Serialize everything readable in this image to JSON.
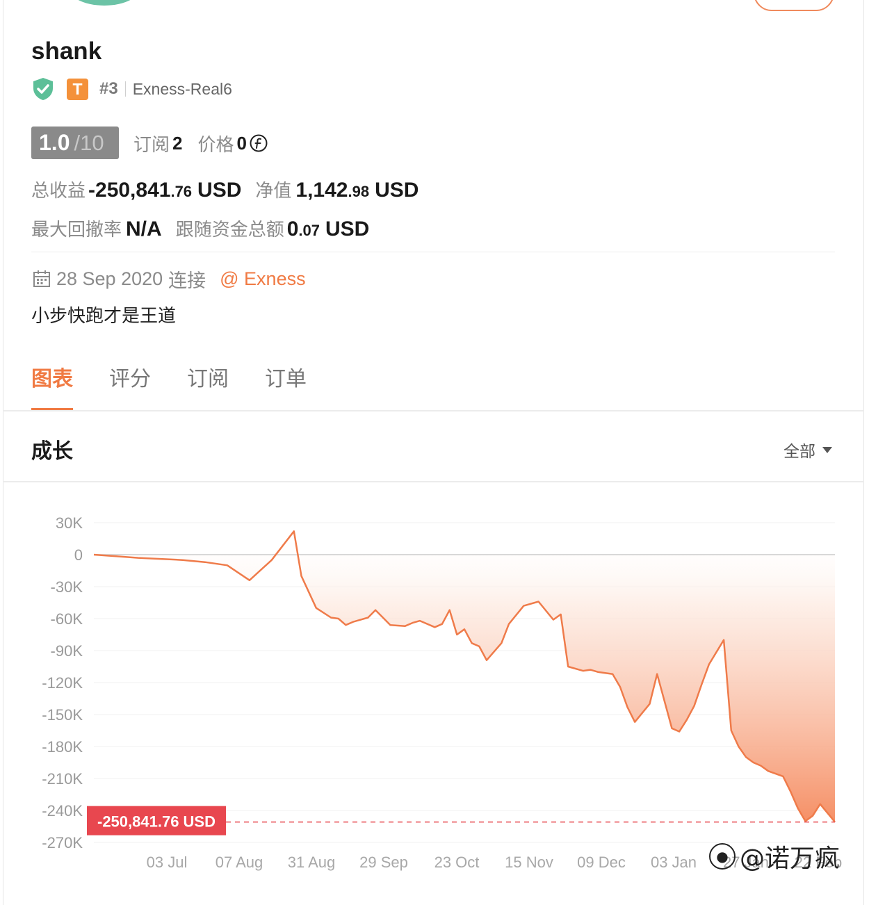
{
  "profile": {
    "name": "shank",
    "rank": "#3",
    "tier_badge": "T",
    "server": "Exness-Real6",
    "score": "1.0",
    "score_max": "/10",
    "subscribe_label": "订阅",
    "subscribe_count": "2",
    "price_label": "价格",
    "price_value": "0",
    "total_profit_label": "总收益",
    "total_profit_main": "-250,841",
    "total_profit_dec": ".76",
    "total_profit_unit": "USD",
    "equity_label": "净值",
    "equity_main": "1,142",
    "equity_dec": ".98",
    "equity_unit": "USD",
    "max_drawdown_label": "最大回撤率",
    "max_drawdown_value": "N/A",
    "follow_funds_label": "跟随资金总额",
    "follow_funds_main": "0",
    "follow_funds_dec": ".07",
    "follow_funds_unit": "USD",
    "connect_date": "28 Sep 2020",
    "connect_label": "连接",
    "broker": "@ Exness",
    "motto": "小步快跑才是王道"
  },
  "tabs": [
    {
      "label": "图表",
      "active": true
    },
    {
      "label": "评分",
      "active": false
    },
    {
      "label": "订阅",
      "active": false
    },
    {
      "label": "订单",
      "active": false
    }
  ],
  "growth": {
    "title": "成长",
    "range": "全部"
  },
  "colors": {
    "accent": "#f07a43",
    "line": "#ef7b4a",
    "badge_red": "#e8474f",
    "shield": "#5cbf98",
    "tier": "#f4913a"
  },
  "icons": [
    "shield-check-icon",
    "coin-icon",
    "calendar-icon",
    "caret-down-icon"
  ],
  "watermark": "@诺万疯",
  "chart_data": {
    "type": "area",
    "ylim": [
      -270000,
      30000
    ],
    "yticks": [
      "30K",
      "0",
      "-30K",
      "-60K",
      "-90K",
      "-120K",
      "-150K",
      "-180K",
      "-210K",
      "-240K",
      "-270K"
    ],
    "xticks": [
      "03 Jul",
      "07 Aug",
      "31 Aug",
      "29 Sep",
      "23 Oct",
      "15 Nov",
      "09 Dec",
      "03 Jan",
      "27 Jan",
      "22 Feb"
    ],
    "last_value_label": "-250,841.76 USD",
    "last_value": -250841.76,
    "series": [
      {
        "x": [
          0,
          3,
          6,
          9,
          12,
          15,
          18,
          21,
          24,
          27,
          28,
          30,
          32,
          33,
          34,
          35,
          37,
          38,
          40,
          42,
          43,
          44,
          46,
          47,
          48,
          49,
          50,
          51,
          52,
          53,
          55,
          56,
          58,
          60,
          62,
          63,
          64,
          66,
          67,
          68,
          70,
          71,
          72,
          73,
          75,
          76,
          78,
          79,
          80,
          81,
          82,
          83,
          85,
          86,
          87,
          88,
          89,
          90,
          91,
          93,
          94,
          95,
          96,
          97,
          98,
          100
        ],
        "values": [
          0,
          -1500,
          -3000,
          -4000,
          -5000,
          -7000,
          -10000,
          -24000,
          -5000,
          22000,
          -20000,
          -50000,
          -59000,
          -60000,
          -66000,
          -63000,
          -59000,
          -52000,
          -66000,
          -67000,
          -64000,
          -62000,
          -68000,
          -65000,
          -52000,
          -75000,
          -70000,
          -83000,
          -86000,
          -99000,
          -83000,
          -65000,
          -48000,
          -44000,
          -61000,
          -56000,
          -105000,
          -109000,
          -108000,
          -110000,
          -112000,
          -124000,
          -143000,
          -157000,
          -140000,
          -112000,
          -163000,
          -166000,
          -155000,
          -142000,
          -122000,
          -103000,
          -80000,
          -165000,
          -180000,
          -190000,
          -195000,
          -198000,
          -203000,
          -208000,
          -222000,
          -238000,
          -250000,
          -245000,
          -234000,
          -250841
        ]
      }
    ]
  }
}
